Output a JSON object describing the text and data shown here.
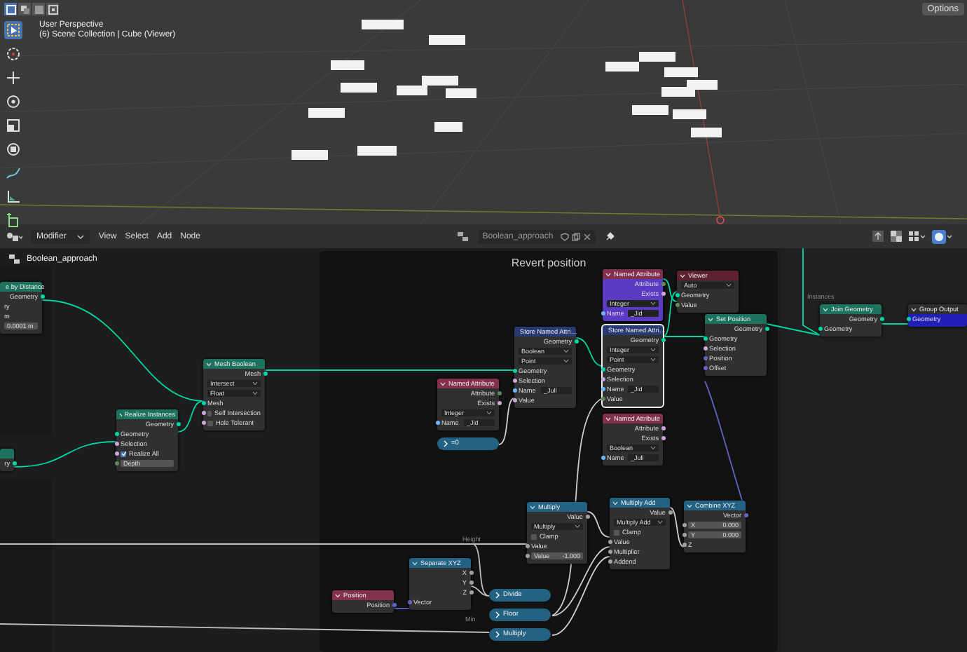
{
  "viewport": {
    "view_name": "User Perspective",
    "collection": "(6) Scene Collection | Cube (Viewer)",
    "options": "Options"
  },
  "header": {
    "editor_menu": "Modifier",
    "menus": [
      "View",
      "Select",
      "Add",
      "Node"
    ],
    "node_tree": "Boolean_approach"
  },
  "breadcrumb": "Boolean_approach",
  "frame": {
    "label": "Revert position"
  },
  "wire_labels": [
    "Instances",
    "Height",
    "Min"
  ],
  "nodes": [
    {
      "kind": "node",
      "title": "e by Distance",
      "color": "#1d725e",
      "selected": false,
      "rows": [
        {
          "kind": "output",
          "label": "Geometry",
          "color": "#00d6a3"
        },
        {
          "kind": "label",
          "label": "ry"
        },
        {
          "kind": "label",
          "label": "m"
        },
        {
          "kind": "field",
          "value": "0.0001 m"
        }
      ]
    },
    {
      "kind": "node",
      "color": "#1d725e",
      "selected": false,
      "rows": [
        {
          "kind": "output",
          "label": "ry",
          "color": "#00d6a3"
        }
      ]
    },
    {
      "kind": "node",
      "title": "Realize Instances",
      "color": "#1d725e",
      "selected": false,
      "rows": [
        {
          "kind": "output",
          "label": "Geometry",
          "color": "#00d6a3"
        },
        {
          "kind": "input",
          "label": "Geometry",
          "color": "#00d6a3"
        },
        {
          "kind": "input",
          "label": "Selection",
          "color": "#cca6d6"
        },
        {
          "kind": "checkbox",
          "label": "Realize All",
          "checked": true,
          "color": "#cca6d6"
        },
        {
          "kind": "field",
          "label": "Depth",
          "color": "#598c5c"
        }
      ]
    },
    {
      "kind": "node",
      "title": "Mesh Boolean",
      "color": "#1d725e",
      "selected": false,
      "rows": [
        {
          "kind": "output",
          "label": "Mesh",
          "color": "#00d6a3"
        },
        {
          "kind": "dropdown",
          "value": "Intersect"
        },
        {
          "kind": "dropdown",
          "value": "Float"
        },
        {
          "kind": "input",
          "label": "Mesh",
          "color": "#00d6a3"
        },
        {
          "kind": "checkbox",
          "label": "Self Intersection",
          "checked": false,
          "color": "#cca6d6"
        },
        {
          "kind": "checkbox",
          "label": "Hole Tolerant",
          "checked": false,
          "color": "#cca6d6"
        }
      ]
    },
    {
      "kind": "node",
      "title": "Named Attribute",
      "color": "#83314a",
      "selected": false,
      "rows": [
        {
          "kind": "output",
          "label": "Attribute",
          "color": "#598c5c"
        },
        {
          "kind": "output",
          "label": "Exists",
          "color": "#cca6d6"
        },
        {
          "kind": "dropdown",
          "value": "Integer"
        },
        {
          "kind": "name_field",
          "label": "Name",
          "value": "_Jid",
          "color": "#70b2ff"
        }
      ]
    },
    {
      "kind": "collapsed",
      "title": "=0",
      "color": "#246283",
      "selected": false
    },
    {
      "kind": "node",
      "title": "Store Named Attri…",
      "color": "#273a71",
      "selected": false,
      "rows": [
        {
          "kind": "output",
          "label": "Geometry",
          "color": "#00d6a3"
        },
        {
          "kind": "dropdown",
          "value": "Boolean"
        },
        {
          "kind": "dropdown",
          "value": "Point"
        },
        {
          "kind": "input",
          "label": "Geometry",
          "color": "#00d6a3"
        },
        {
          "kind": "input",
          "label": "Selection",
          "color": "#cca6d6"
        },
        {
          "kind": "name_field",
          "label": "Name",
          "value": "_Jull",
          "color": "#70b2ff"
        },
        {
          "kind": "input",
          "label": "Value",
          "color": "#cca6d6"
        }
      ]
    },
    {
      "kind": "node",
      "title": "Named Attribute",
      "color": "#83314a",
      "body": {
        "color": "#5a3bc4"
      },
      "selected": false,
      "rows": [
        {
          "kind": "output",
          "label": "Attribute",
          "color": "#598c5c"
        },
        {
          "kind": "output",
          "label": "Exists",
          "color": "#cca6d6"
        },
        {
          "kind": "dropdown",
          "value": "Integer"
        },
        {
          "kind": "name_field",
          "label": "Name",
          "value": "_Jid",
          "color": "#70b2ff"
        }
      ]
    },
    {
      "kind": "node",
      "title": "Viewer",
      "color": "#5e2130",
      "selected": false,
      "rows": [
        {
          "kind": "dropdown",
          "value": "Auto"
        },
        {
          "kind": "input",
          "label": "Geometry",
          "color": "#00d6a3"
        },
        {
          "kind": "input",
          "label": "Value",
          "color": "#598c5c"
        }
      ]
    },
    {
      "kind": "node",
      "title": "Store Named Attri…",
      "color": "#273a71",
      "selected": true,
      "rows": [
        {
          "kind": "output",
          "label": "Geometry",
          "color": "#00d6a3"
        },
        {
          "kind": "dropdown",
          "value": "Integer"
        },
        {
          "kind": "dropdown",
          "value": "Point"
        },
        {
          "kind": "input",
          "label": "Geometry",
          "color": "#00d6a3"
        },
        {
          "kind": "input",
          "label": "Selection",
          "color": "#cca6d6"
        },
        {
          "kind": "name_field",
          "label": "Name",
          "value": "_Jid",
          "color": "#70b2ff"
        },
        {
          "kind": "input",
          "label": "Value",
          "color": "#598c5c"
        }
      ]
    },
    {
      "kind": "node",
      "title": "Named Attribute",
      "color": "#83314a",
      "selected": false,
      "rows": [
        {
          "kind": "output",
          "label": "Attribute",
          "color": "#cca6d6"
        },
        {
          "kind": "output",
          "label": "Exists",
          "color": "#cca6d6"
        },
        {
          "kind": "dropdown",
          "value": "Boolean"
        },
        {
          "kind": "name_field",
          "label": "Name",
          "value": "_Jull",
          "color": "#70b2ff"
        }
      ]
    },
    {
      "kind": "node",
      "title": "Set Position",
      "color": "#1d725e",
      "selected": false,
      "rows": [
        {
          "kind": "output",
          "label": "Geometry",
          "color": "#00d6a3"
        },
        {
          "kind": "input",
          "label": "Geometry",
          "color": "#00d6a3"
        },
        {
          "kind": "input",
          "label": "Selection",
          "color": "#cca6d6"
        },
        {
          "kind": "input",
          "label": "Position",
          "color": "#6363c7"
        },
        {
          "kind": "input",
          "label": "Offset",
          "color": "#6363c7"
        }
      ]
    },
    {
      "kind": "node",
      "title": "Join Geometry",
      "color": "#1d725e",
      "selected": false,
      "rows": [
        {
          "kind": "output",
          "label": "Geometry",
          "color": "#00d6a3"
        },
        {
          "kind": "input",
          "label": "Geometry",
          "color": "#00d6a3"
        }
      ]
    },
    {
      "kind": "node",
      "title": "Group Output",
      "color": "#2e2e2e",
      "body": {
        "color": "#2020b8"
      },
      "selected": false,
      "rows": [
        {
          "kind": "input",
          "label": "Geometry",
          "color": "#00d6a3"
        }
      ]
    },
    {
      "kind": "node",
      "title": "Multiply",
      "color": "#246283",
      "selected": false,
      "rows": [
        {
          "kind": "output",
          "label": "Value",
          "color": "#a1a1a1"
        },
        {
          "kind": "dropdown",
          "value": "Multiply"
        },
        {
          "kind": "checkbox",
          "label": "Clamp",
          "checked": false
        },
        {
          "kind": "input",
          "label": "Value",
          "color": "#a1a1a1"
        },
        {
          "kind": "field",
          "label": "Value",
          "value": "-1.000",
          "color": "#a1a1a1"
        }
      ]
    },
    {
      "kind": "node",
      "title": "Multiply Add",
      "color": "#246283",
      "selected": false,
      "rows": [
        {
          "kind": "output",
          "label": "Value",
          "color": "#a1a1a1"
        },
        {
          "kind": "dropdown",
          "value": "Multiply Add"
        },
        {
          "kind": "checkbox",
          "label": "Clamp",
          "checked": false
        },
        {
          "kind": "input",
          "label": "Value",
          "color": "#a1a1a1"
        },
        {
          "kind": "input",
          "label": "Multiplier",
          "color": "#a1a1a1"
        },
        {
          "kind": "input",
          "label": "Addend",
          "color": "#a1a1a1"
        }
      ]
    },
    {
      "kind": "node",
      "title": "Combine XYZ",
      "color": "#246283",
      "selected": false,
      "rows": [
        {
          "kind": "output",
          "label": "Vector",
          "color": "#6363c7"
        },
        {
          "kind": "field",
          "label": "X",
          "value": "0.000",
          "color": "#a1a1a1"
        },
        {
          "kind": "field",
          "label": "Y",
          "value": "0.000",
          "color": "#a1a1a1"
        },
        {
          "kind": "input",
          "label": "Z",
          "color": "#a1a1a1"
        }
      ]
    },
    {
      "kind": "node",
      "title": "Position",
      "color": "#83314a",
      "selected": false,
      "rows": [
        {
          "kind": "output",
          "label": "Position",
          "color": "#6363c7"
        }
      ]
    },
    {
      "kind": "node",
      "title": "Separate XYZ",
      "color": "#246283",
      "selected": false,
      "rows": [
        {
          "kind": "output",
          "label": "X",
          "color": "#a1a1a1"
        },
        {
          "kind": "output",
          "label": "Y",
          "color": "#a1a1a1"
        },
        {
          "kind": "output",
          "label": "Z",
          "color": "#a1a1a1"
        },
        {
          "kind": "input",
          "label": "Vector",
          "color": "#6363c7"
        }
      ]
    },
    {
      "kind": "collapsed",
      "title": "Divide",
      "color": "#246283",
      "selected": false
    },
    {
      "kind": "collapsed",
      "title": "Floor",
      "color": "#246283",
      "selected": false
    },
    {
      "kind": "collapsed",
      "title": "Multiply",
      "color": "#246283",
      "selected": false
    }
  ]
}
